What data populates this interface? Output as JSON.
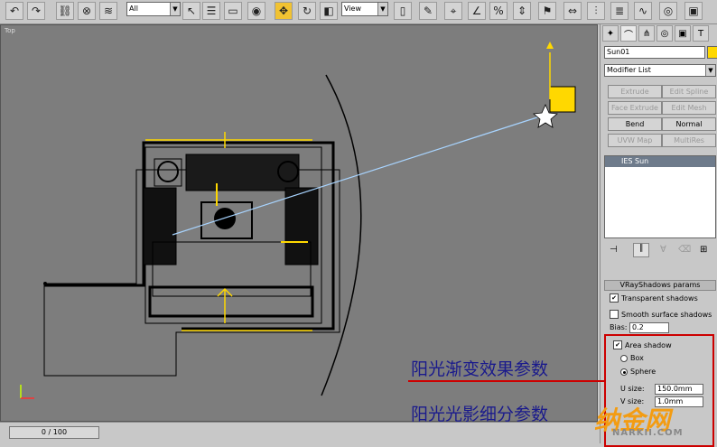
{
  "toolbar": {
    "filter_select": "All",
    "view_select": "View"
  },
  "viewport": {
    "label": "Top"
  },
  "cmd": {
    "object_name": "Sun01",
    "modifier_list": "Modifier List",
    "buttons": [
      {
        "label": "Extrude",
        "enabled": false
      },
      {
        "label": "Edit Spline",
        "enabled": false
      },
      {
        "label": "Face Extrude",
        "enabled": false
      },
      {
        "label": "Edit Mesh",
        "enabled": false
      },
      {
        "label": "Bend",
        "enabled": true
      },
      {
        "label": "Normal",
        "enabled": true
      },
      {
        "label": "UVW Map",
        "enabled": false
      },
      {
        "label": "MultiRes",
        "enabled": false
      }
    ],
    "stack_item": "IES Sun",
    "rollout_title": "VRayShadows params",
    "transparent_shadows": "Transparent shadows",
    "smooth_surface_shadows": "Smooth surface shadows",
    "bias_label": "Bias:",
    "bias_value": "0.2",
    "area_shadow": "Area shadow",
    "box_label": "Box",
    "sphere_label": "Sphere",
    "u_size_label": "U size:",
    "u_size_value": "150.0mm",
    "v_size_label": "V size:",
    "v_size_value": "1.0mm"
  },
  "annotations": {
    "top": "阳光渐变效果参数",
    "bottom": "阳光光影细分参数"
  },
  "status": {
    "time": "0 / 100"
  },
  "watermark": {
    "logo": "纳金网",
    "site": "NARKII.COM"
  },
  "colors": {
    "viewport_bg": "#7d7d7d",
    "drawing": "#000000",
    "sun_ray": "#a8d4ff",
    "gizmo_yellow": "#ffd800",
    "annotation_red": "#cc0000",
    "annotation_text": "#1a1a8c"
  }
}
